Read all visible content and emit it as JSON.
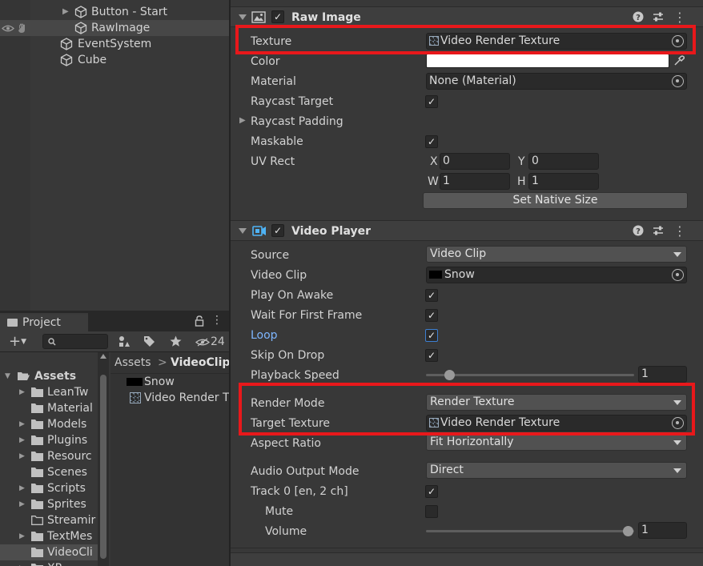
{
  "hierarchy": {
    "items": [
      {
        "label": "Button - Start"
      },
      {
        "label": "RawImage"
      },
      {
        "label": "EventSystem"
      },
      {
        "label": "Cube"
      }
    ]
  },
  "project": {
    "tab_label": "Project",
    "add_label": "+",
    "hidden_count": "24",
    "breadcrumb_root": "Assets",
    "breadcrumb_sep": ">",
    "breadcrumb_current": "VideoClip",
    "tree": [
      {
        "label": "Assets"
      },
      {
        "label": "LeanTw"
      },
      {
        "label": "Material"
      },
      {
        "label": "Models"
      },
      {
        "label": "Plugins"
      },
      {
        "label": "Resourc"
      },
      {
        "label": "Scenes"
      },
      {
        "label": "Scripts"
      },
      {
        "label": "Sprites"
      },
      {
        "label": "Streamir"
      },
      {
        "label": "TextMes"
      },
      {
        "label": "VideoCli"
      },
      {
        "label": "XR"
      }
    ],
    "files": [
      {
        "label": "Snow"
      },
      {
        "label": "Video Render T"
      }
    ]
  },
  "raw_image": {
    "title": "Raw Image",
    "texture_label": "Texture",
    "texture_value": "Video Render Texture",
    "color_label": "Color",
    "material_label": "Material",
    "material_value": "None (Material)",
    "raycast_target_label": "Raycast Target",
    "raycast_padding_label": "Raycast Padding",
    "maskable_label": "Maskable",
    "uv_rect_label": "UV Rect",
    "uv_x_label": "X",
    "uv_x": "0",
    "uv_y_label": "Y",
    "uv_y": "0",
    "uv_w_label": "W",
    "uv_w": "1",
    "uv_h_label": "H",
    "uv_h": "1",
    "set_native_size": "Set Native Size"
  },
  "video_player": {
    "title": "Video Player",
    "source_label": "Source",
    "source_value": "Video Clip",
    "video_clip_label": "Video Clip",
    "video_clip_value": "Snow",
    "play_on_awake_label": "Play On Awake",
    "wait_first_frame_label": "Wait For First Frame",
    "loop_label": "Loop",
    "skip_on_drop_label": "Skip On Drop",
    "playback_speed_label": "Playback Speed",
    "playback_speed_value": "1",
    "render_mode_label": "Render Mode",
    "render_mode_value": "Render Texture",
    "target_texture_label": "Target Texture",
    "target_texture_value": "Video Render Texture",
    "aspect_ratio_label": "Aspect Ratio",
    "aspect_ratio_value": "Fit Horizontally",
    "audio_output_label": "Audio Output Mode",
    "audio_output_value": "Direct",
    "track_label": "Track 0 [en, 2 ch]",
    "mute_label": "Mute",
    "volume_label": "Volume",
    "volume_value": "1",
    "checkmark": "✓"
  },
  "colors": {
    "highlight": "#e8181b",
    "loop_label": "#7eb6ff",
    "color_swatch": "#ffffff"
  }
}
